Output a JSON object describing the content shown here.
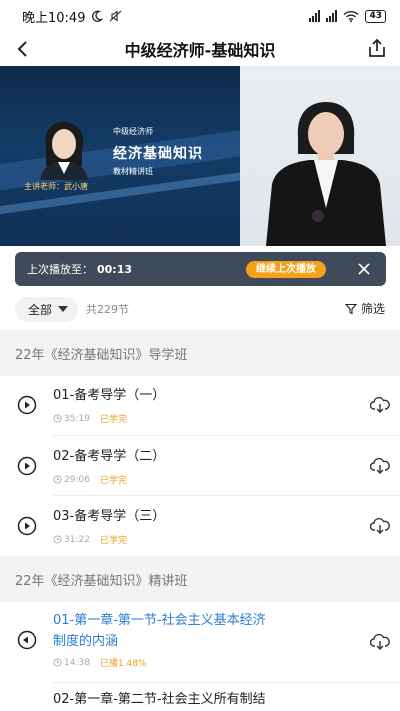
{
  "status_bar": {
    "time": "晚上10:49",
    "battery": "43"
  },
  "nav": {
    "title": "中级经济师-基础知识",
    "back_icon": "chevron-left-icon",
    "share_icon": "share-icon"
  },
  "video": {
    "subtitle": "中级经济师",
    "main_title": "经济基础知识",
    "class_name": "教材精讲班",
    "teacher": "主讲老师：武小唐"
  },
  "resume": {
    "label": "上次播放至：",
    "time": "00:13",
    "button": "继续上次播放"
  },
  "filter": {
    "selected": "全部",
    "count": "共229节",
    "screen_label": "筛选"
  },
  "sections": [
    {
      "title": "22年《经济基础知识》导学班",
      "lessons": [
        {
          "title": "01-备考导学（一）",
          "duration": "35:19",
          "status": "已学完"
        },
        {
          "title": "02-备考导学（二）",
          "duration": "29:06",
          "status": "已学完"
        },
        {
          "title": "03-备考导学（三）",
          "duration": "31:22",
          "status": "已学完"
        }
      ]
    },
    {
      "title": "22年《经济基础知识》精讲班",
      "lessons": [
        {
          "title_line1": "01-第一章-第一节-社会主义基本经济",
          "title_line2": "制度的内涵",
          "duration": "14:38",
          "status": "已播1.48%"
        },
        {
          "title": "02-第一章-第二节-社会主义所有制结"
        }
      ]
    }
  ],
  "colors": {
    "accent_orange": "#f5a21b",
    "active_blue": "#2d7dd2",
    "resume_bg": "#3f4a5a"
  }
}
